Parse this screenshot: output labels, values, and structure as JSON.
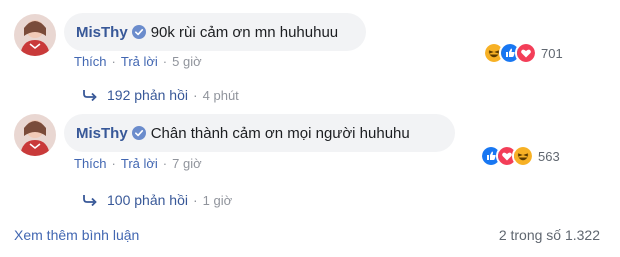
{
  "comments": [
    {
      "author": "MisThy",
      "text": "90k rùi cảm ơn mn huhuhuu",
      "like_label": "Thích",
      "reply_label": "Trả lời",
      "time": "5 giờ",
      "reaction_icons": [
        "haha-icon",
        "like-icon",
        "love-icon"
      ],
      "reaction_count": "701",
      "replies_label": "192 phản hồi",
      "replies_time": "4 phút"
    },
    {
      "author": "MisThy",
      "text": "Chân thành cảm ơn mọi người huhuhu",
      "like_label": "Thích",
      "reply_label": "Trả lời",
      "time": "7 giờ",
      "reaction_icons": [
        "like-icon",
        "love-icon",
        "haha-icon"
      ],
      "reaction_count": "563",
      "replies_label": "100 phản hồi",
      "replies_time": "1 giờ"
    }
  ],
  "footer": {
    "more_comments": "Xem thêm bình luận",
    "pagination": "2 trong số 1.322"
  },
  "colors": {
    "link": "#385898",
    "secondary_link": "#4267b2",
    "bubble": "#f2f3f5",
    "like": "#1877f2",
    "love": "#f33e58",
    "haha": "#f7b125"
  }
}
